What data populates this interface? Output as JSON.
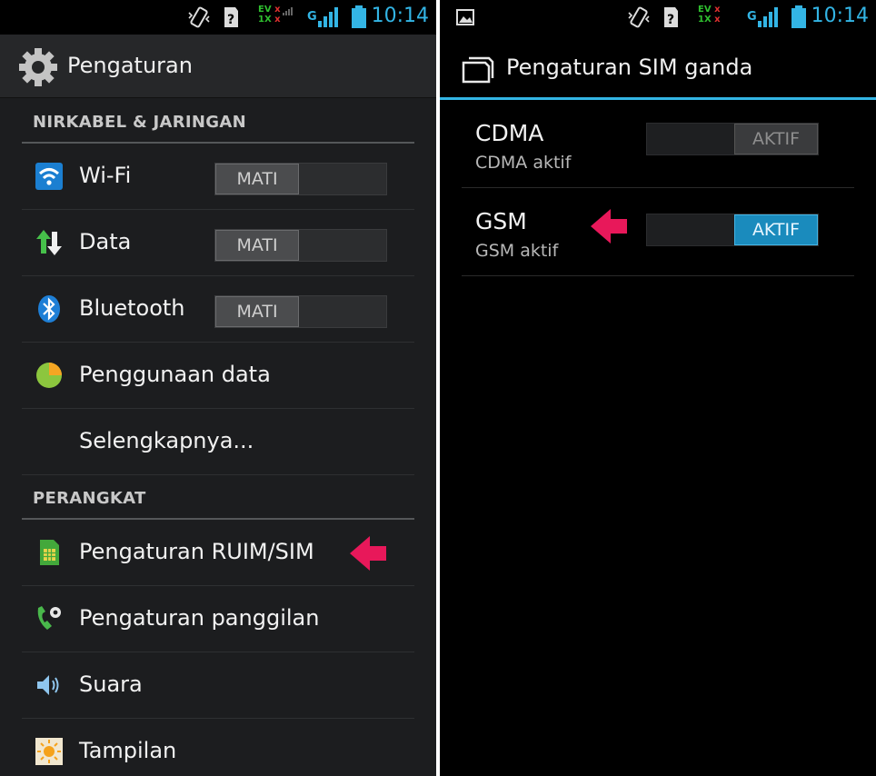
{
  "status_bar": {
    "time": "10:14",
    "network_top": "EV",
    "network_bottom": "1X",
    "signal_label": "G",
    "x_mark": "x",
    "colors": {
      "time": "#33b5e5",
      "ev": "#2fbf2f",
      "x": "#e03030"
    }
  },
  "left_screen": {
    "title": "Pengaturan",
    "sections": [
      {
        "header": "NIRKABEL & JARINGAN",
        "items": [
          {
            "label": "Wi-Fi",
            "icon": "wifi-icon",
            "toggle": "MATI"
          },
          {
            "label": "Data",
            "icon": "data-transfer-icon",
            "toggle": "MATI"
          },
          {
            "label": "Bluetooth",
            "icon": "bluetooth-icon",
            "toggle": "MATI"
          },
          {
            "label": "Penggunaan data",
            "icon": "data-usage-icon"
          },
          {
            "label": "Selengkapnya..."
          }
        ]
      },
      {
        "header": "PERANGKAT",
        "items": [
          {
            "label": "Pengaturan RUIM/SIM",
            "icon": "sim-card-icon",
            "highlighted": true
          },
          {
            "label": "Pengaturan panggilan",
            "icon": "call-settings-icon"
          },
          {
            "label": "Suara",
            "icon": "speaker-icon"
          },
          {
            "label": "Tampilan",
            "icon": "brightness-icon"
          }
        ]
      }
    ]
  },
  "right_screen": {
    "title": "Pengaturan SIM ganda",
    "items": [
      {
        "name": "CDMA",
        "subtitle": "CDMA aktif",
        "toggle": "AKTIF",
        "state": "dim"
      },
      {
        "name": "GSM",
        "subtitle": "GSM aktif",
        "toggle": "AKTIF",
        "state": "lit",
        "highlighted": true
      }
    ]
  },
  "colors": {
    "accent": "#33b5e5",
    "toggle_on": "#1a8bbd",
    "arrow": "#e8185a"
  }
}
